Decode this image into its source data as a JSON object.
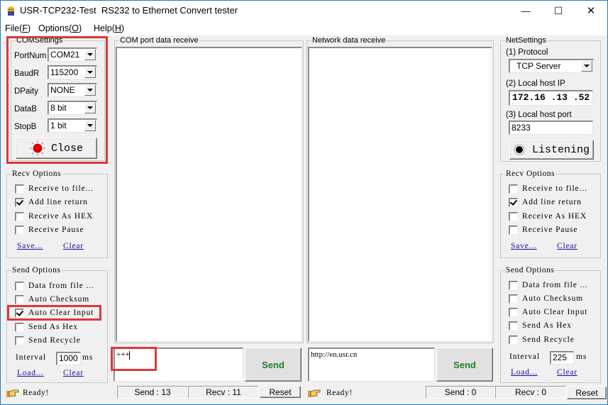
{
  "window": {
    "title": "USR-TCP232-Test  RS232 to Ethernet Convert tester",
    "controls": {
      "minimize": "—",
      "maximize": "☐",
      "close": "✕"
    }
  },
  "menu": [
    {
      "label": "File",
      "accel": "F"
    },
    {
      "label": "Options",
      "accel": "O"
    },
    {
      "label": "Help",
      "accel": "H"
    }
  ],
  "com_settings": {
    "title": "COMSettings",
    "fields": [
      {
        "label": "PortNum",
        "value": "COM21"
      },
      {
        "label": "BaudR",
        "value": "115200"
      },
      {
        "label": "DPaity",
        "value": "NONE"
      },
      {
        "label": "DataB",
        "value": "8 bit"
      },
      {
        "label": "StopB",
        "value": "1 bit"
      }
    ],
    "button": {
      "label": "Close",
      "indicator_color": "#e00000"
    }
  },
  "left_recv_options": {
    "title": "Recv Options",
    "items": [
      {
        "label": "Receive to file...",
        "checked": false
      },
      {
        "label": "Add line return",
        "checked": true
      },
      {
        "label": "Receive As HEX",
        "checked": false
      },
      {
        "label": "Receive Pause",
        "checked": false
      }
    ],
    "save_link": "Save...",
    "clear_link": "Clear"
  },
  "left_send_options": {
    "title": "Send Options",
    "items": [
      {
        "label": "Data from file ...",
        "checked": false
      },
      {
        "label": "Auto Checksum",
        "checked": false
      },
      {
        "label": "Auto Clear Input",
        "checked": true
      },
      {
        "label": "Send As Hex",
        "checked": false
      },
      {
        "label": "Send Recycle",
        "checked": false
      }
    ],
    "interval_label": "Interval",
    "interval_value": "1000",
    "interval_unit": "ms",
    "load_link": "Load...",
    "clear_link": "Clear"
  },
  "com_receive": {
    "title": "COM port data receive",
    "content": ""
  },
  "net_receive": {
    "title": "Network data receive",
    "content": ""
  },
  "com_send": {
    "input_value": "+++",
    "send_label": "Send"
  },
  "net_send": {
    "input_value": "http://en.usr.cn",
    "send_label": "Send"
  },
  "net_settings": {
    "title": "NetSettings",
    "protocol_label": "(1) Protocol",
    "protocol_value": "TCP Server",
    "ip_label": "(2) Local host IP",
    "ip_value": "172.16 .13 .52",
    "port_label": "(3) Local host port",
    "port_value": "8233",
    "button": {
      "label": "Listening",
      "indicator_color": "#000000"
    }
  },
  "right_recv_options": {
    "title": "Recv Options",
    "items": [
      {
        "label": "Receive to file...",
        "checked": false
      },
      {
        "label": "Add line return",
        "checked": true
      },
      {
        "label": "Receive As HEX",
        "checked": false
      },
      {
        "label": "Receive Pause",
        "checked": false
      }
    ],
    "save_link": "Save...",
    "clear_link": "Clear"
  },
  "right_send_options": {
    "title": "Send Options",
    "items": [
      {
        "label": "Data from file ...",
        "checked": false
      },
      {
        "label": "Auto Checksum",
        "checked": false
      },
      {
        "label": "Auto Clear Input",
        "checked": false
      },
      {
        "label": "Send As Hex",
        "checked": false
      },
      {
        "label": "Send Recycle",
        "checked": false
      }
    ],
    "interval_label": "Interval",
    "interval_value": "225",
    "interval_unit": "ms",
    "load_link": "Load...",
    "clear_link": "Clear"
  },
  "status_left": {
    "ready": "Ready!",
    "send": "Send : 13",
    "recv": "Recv : 11",
    "reset": "Reset"
  },
  "status_right": {
    "ready": "Ready!",
    "send": "Send : 0",
    "recv": "Recv : 0",
    "reset": "Reset"
  },
  "colors": {
    "highlight": "#d9393c",
    "send_text": "#1e7f2a",
    "link": "#1a0dab",
    "window_border": "#2b79b7"
  }
}
